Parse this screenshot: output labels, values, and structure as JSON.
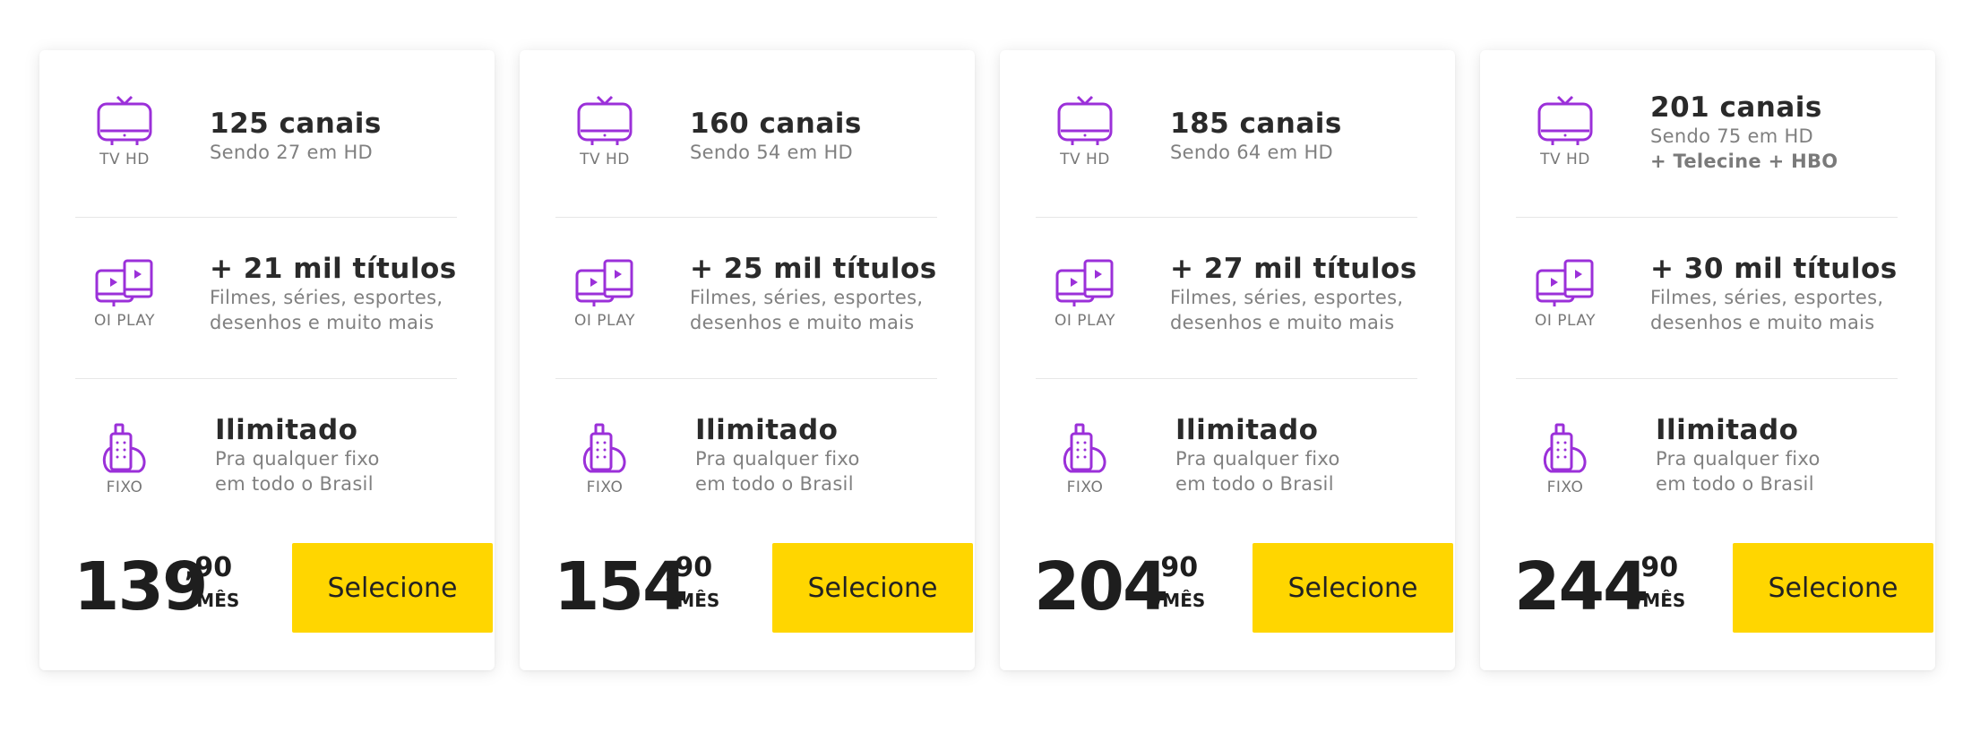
{
  "colors": {
    "accent_purple": "#9b30d9",
    "button_yellow": "#ffd600"
  },
  "plans": [
    {
      "tv": {
        "icon": "tv-icon",
        "label": "TV HD",
        "title": "125 canais",
        "sub1": "Sendo 27 em HD",
        "sub2": ""
      },
      "play": {
        "icon": "oi-play-icon",
        "label": "OI PLAY",
        "title": "+ 21 mil títulos",
        "sub1": "Filmes, séries, esportes,",
        "sub2": "desenhos e muito mais"
      },
      "fixo": {
        "icon": "phone-icon",
        "label": "FIXO",
        "title": "Ilimitado",
        "sub1": "Pra qualquer fixo",
        "sub2": "em todo o Brasil"
      },
      "price": {
        "int": "139",
        "cents": ",90",
        "period": "/MÊS"
      },
      "button": "Selecione"
    },
    {
      "tv": {
        "icon": "tv-icon",
        "label": "TV HD",
        "title": "160 canais",
        "sub1": "Sendo 54 em HD",
        "sub2": ""
      },
      "play": {
        "icon": "oi-play-icon",
        "label": "OI PLAY",
        "title": "+ 25 mil títulos",
        "sub1": "Filmes, séries, esportes,",
        "sub2": "desenhos e muito mais"
      },
      "fixo": {
        "icon": "phone-icon",
        "label": "FIXO",
        "title": "Ilimitado",
        "sub1": "Pra qualquer fixo",
        "sub2": "em todo o Brasil"
      },
      "price": {
        "int": "154",
        "cents": ",90",
        "period": "/MÊS"
      },
      "button": "Selecione"
    },
    {
      "tv": {
        "icon": "tv-icon",
        "label": "TV HD",
        "title": "185 canais",
        "sub1": "Sendo 64 em HD",
        "sub2": ""
      },
      "play": {
        "icon": "oi-play-icon",
        "label": "OI PLAY",
        "title": "+ 27 mil títulos",
        "sub1": "Filmes, séries, esportes,",
        "sub2": "desenhos e muito mais"
      },
      "fixo": {
        "icon": "phone-icon",
        "label": "FIXO",
        "title": "Ilimitado",
        "sub1": "Pra qualquer fixo",
        "sub2": "em todo o Brasil"
      },
      "price": {
        "int": "204",
        "cents": ",90",
        "period": "/MÊS"
      },
      "button": "Selecione"
    },
    {
      "tv": {
        "icon": "tv-icon",
        "label": "TV HD",
        "title": "201 canais",
        "sub1": "Sendo 75 em HD",
        "sub2": "+ Telecine + HBO"
      },
      "play": {
        "icon": "oi-play-icon",
        "label": "OI PLAY",
        "title": "+ 30 mil títulos",
        "sub1": "Filmes, séries, esportes,",
        "sub2": "desenhos e muito mais"
      },
      "fixo": {
        "icon": "phone-icon",
        "label": "FIXO",
        "title": "Ilimitado",
        "sub1": "Pra qualquer fixo",
        "sub2": "em todo o Brasil"
      },
      "price": {
        "int": "244",
        "cents": ",90",
        "period": "/MÊS"
      },
      "button": "Selecione"
    }
  ]
}
